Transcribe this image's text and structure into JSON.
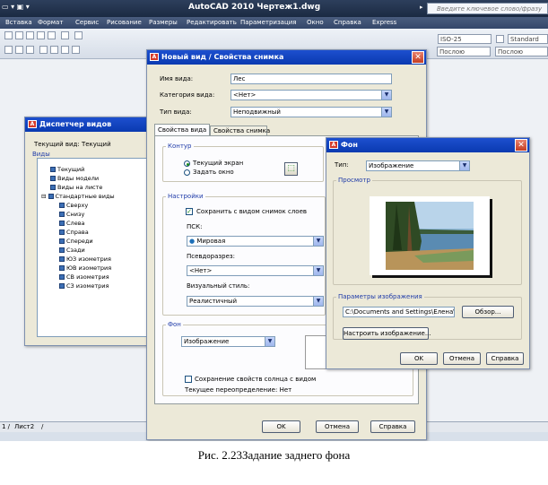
{
  "app": {
    "title": "AutoCAD 2010   Чертеж1.dwg",
    "search_placeholder": "Введите ключевое слово/фразу"
  },
  "menu": [
    "Вставка",
    "Формат",
    "Сервис",
    "Рисование",
    "Размеры",
    "Редактировать",
    "Параметризация",
    "Окно",
    "Справка",
    "Express"
  ],
  "toolbar": {
    "style_box": "ISO-25",
    "standard_box": "Standard",
    "linetype_box": "Послою",
    "lineweight_box": "Послою"
  },
  "layout_tab": "Лист2",
  "view_manager": {
    "title": "Диспетчер видов",
    "current_view_label": "Текущий вид: Текущий",
    "views_label": "Виды",
    "tree": [
      "Текущий",
      "Виды модели",
      "Виды на листе",
      "Стандартные виды",
      "Сверху",
      "Снизу",
      "Слева",
      "Справа",
      "Спереди",
      "Сзади",
      "ЮЗ изометрия",
      "ЮВ изометрия",
      "СВ изометрия",
      "СЗ изометрия"
    ]
  },
  "new_view": {
    "title": "Новый вид / Свойства снимка",
    "view_name_label": "Имя вида:",
    "view_name_value": "Лес",
    "category_label": "Категория вида:",
    "category_value": "<Нет>",
    "view_type_label": "Тип вида:",
    "view_type_value": "Неподвижный",
    "tabs": [
      "Свойства вида",
      "Свойства снимка"
    ],
    "boundary_group": "Контур",
    "radio_current_display": "Текущий экран",
    "radio_define_window": "Задать окно",
    "settings_group": "Настройки",
    "save_layer_snapshot": "Сохранить с видом снимок слоев",
    "ucs_label": "ПСК:",
    "ucs_value": "Мировая",
    "live_section_label": "Псевдоразрез:",
    "live_section_value": "<Нет>",
    "visual_style_label": "Визуальный стиль:",
    "visual_style_value": "Реалистичный",
    "background_group": "Фон",
    "background_value": "Изображение",
    "save_sun_properties": "Сохранение свойств солнца с видом",
    "current_override": "Текущее переопределение: Нет",
    "ok": "OK",
    "cancel": "Отмена",
    "help": "Справка"
  },
  "background": {
    "title": "Фон",
    "type_label": "Тип:",
    "type_value": "Изображение",
    "preview_label": "Просмотр",
    "image_options_label": "Параметры изображения",
    "image_path": "C:\\Documents and Settings\\Елена\\Мо",
    "browse": "Обзор...",
    "adjust_image": "Настроить изображение...",
    "ok": "OK",
    "cancel": "Отмена",
    "help": "Справка"
  },
  "caption": "Рис. 2.23Задание заднего фона"
}
